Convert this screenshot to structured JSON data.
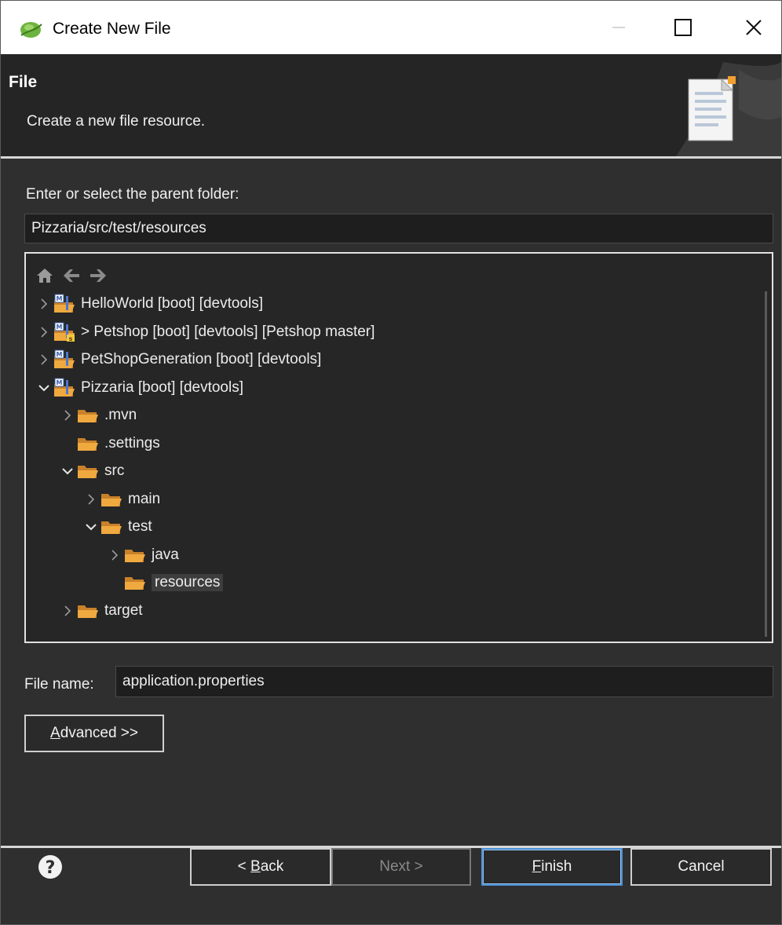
{
  "window": {
    "title": "Create New File",
    "controls": [
      "minimize",
      "maximize",
      "close"
    ]
  },
  "banner": {
    "title": "File",
    "description": "Create a new file resource.",
    "icon": "file-wizard-icon"
  },
  "parent_folder": {
    "label": "Enter or select the parent folder:",
    "value": "Pizzaria/src/test/resources"
  },
  "tree": {
    "nav_icons": [
      "home-icon",
      "back-arrow-icon",
      "forward-arrow-icon"
    ],
    "rows": [
      {
        "label": "HelloWorld [boot] [devtools]",
        "icon": "spring-boot-project-icon",
        "twisty": "collapsed",
        "depth": 0
      },
      {
        "label": "> Petshop [boot] [devtools] [Petshop master]",
        "icon": "spring-boot-git-project-icon",
        "twisty": "collapsed",
        "depth": 0
      },
      {
        "label": "PetShopGeneration [boot] [devtools]",
        "icon": "spring-boot-project-icon",
        "twisty": "collapsed",
        "depth": 0
      },
      {
        "label": "Pizzaria [boot] [devtools]",
        "icon": "spring-boot-project-icon",
        "twisty": "expanded",
        "depth": 0
      },
      {
        "label": ".mvn",
        "icon": "folder-icon",
        "twisty": "collapsed",
        "depth": 1
      },
      {
        "label": ".settings",
        "icon": "folder-icon",
        "twisty": "none",
        "depth": 1
      },
      {
        "label": "src",
        "icon": "folder-icon",
        "twisty": "expanded",
        "depth": 1
      },
      {
        "label": "main",
        "icon": "folder-icon",
        "twisty": "collapsed",
        "depth": 2
      },
      {
        "label": "test",
        "icon": "folder-icon",
        "twisty": "expanded",
        "depth": 2
      },
      {
        "label": "java",
        "icon": "folder-icon",
        "twisty": "collapsed",
        "depth": 3
      },
      {
        "label": "resources",
        "icon": "folder-icon",
        "twisty": "none",
        "depth": 3,
        "selected": true
      },
      {
        "label": "target",
        "icon": "folder-icon",
        "twisty": "collapsed",
        "depth": 1
      }
    ]
  },
  "file_name": {
    "label": "File name:",
    "value": "application.properties"
  },
  "advanced_button": {
    "mnemonic": "A",
    "rest": "dvanced >>"
  },
  "footer": {
    "help_icon": "help-icon",
    "back": {
      "prefix": "< ",
      "mnemonic": "B",
      "rest": "ack"
    },
    "next": "Next >",
    "finish": {
      "mnemonic": "F",
      "rest": "inish"
    },
    "cancel": "Cancel"
  },
  "colors": {
    "background": "#2f2f2f",
    "banner": "#252526",
    "folder": "#e8a03a",
    "default_button_border": "#4a8fd4"
  }
}
